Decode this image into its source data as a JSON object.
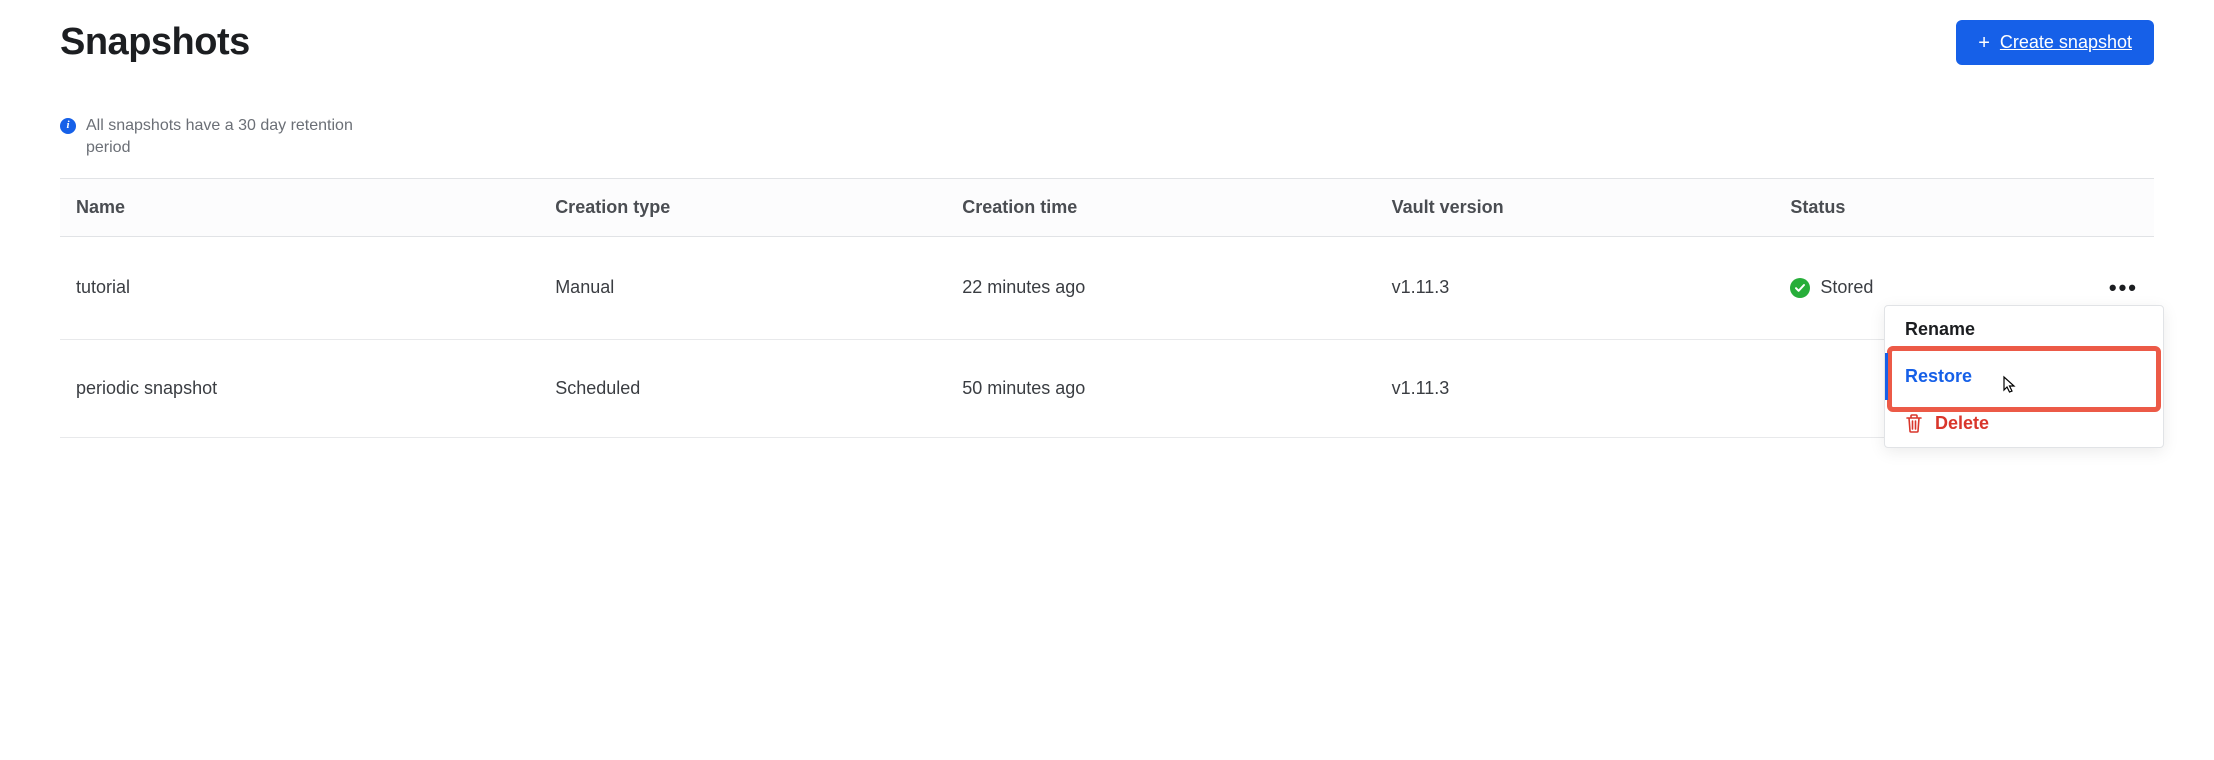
{
  "header": {
    "title": "Snapshots",
    "create_button_label": "Create snapshot"
  },
  "info": {
    "message": "All snapshots have a 30 day retention period"
  },
  "table": {
    "columns": [
      "Name",
      "Creation type",
      "Creation time",
      "Vault version",
      "Status"
    ],
    "rows": [
      {
        "name": "tutorial",
        "creation_type": "Manual",
        "creation_time": "22 minutes ago",
        "vault_version": "v1.11.3",
        "status": "Stored"
      },
      {
        "name": "periodic snapshot",
        "creation_type": "Scheduled",
        "creation_time": "50 minutes ago",
        "vault_version": "v1.11.3",
        "status": ""
      }
    ]
  },
  "menu": {
    "rename": "Rename",
    "restore": "Restore",
    "delete": "Delete"
  }
}
